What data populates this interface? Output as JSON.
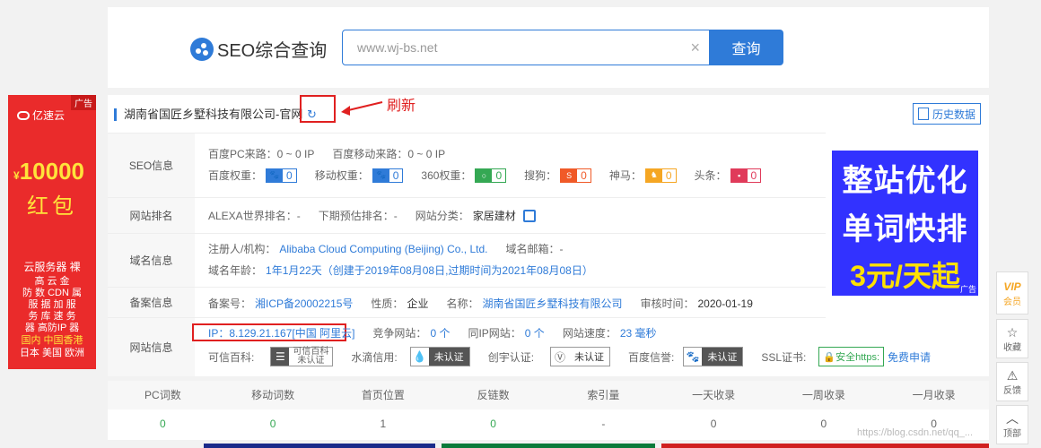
{
  "header": {
    "logo_text": "SEO综合查询",
    "search_value": "www.wj-bs.net",
    "search_button": "查询"
  },
  "left_ad": {
    "tag": "广告",
    "brand": "亿速云",
    "amount_prefix": "¥",
    "amount": "10000",
    "hongbao": "红包",
    "lines": [
      "云服务器 裸",
      "高 云 金",
      "防 数 CDN 属",
      "服 据 加 服",
      "务 库 速 务",
      "器 高防IP 器",
      "国内 中国香港",
      "日本 美国 欧洲"
    ]
  },
  "company": {
    "title": "湖南省国匠乡墅科技有限公司-官网",
    "refresh_annotation": "刷新",
    "history_button": "历史数据"
  },
  "seo_info": {
    "label": "SEO信息",
    "pc_traffic": "百度PC来路：0 ~ 0 IP",
    "mobile_traffic": "百度移动来路：0 ~ 0 IP",
    "baidu_weight_label": "百度权重：",
    "baidu_weight": "0",
    "mobile_weight_label": "移动权重：",
    "mobile_weight": "0",
    "weight360_label": "360权重：",
    "weight360": "0",
    "sogou_label": "搜狗：",
    "sogou": "0",
    "shenma_label": "神马：",
    "shenma": "0",
    "toutiao_label": "头条：",
    "toutiao": "0"
  },
  "site_rank": {
    "label": "网站排名",
    "alexa": "ALEXA世界排名：-",
    "forecast": "下期预估排名：-",
    "category_label": "网站分类：",
    "category": "家居建材"
  },
  "domain_info": {
    "label": "域名信息",
    "registrant_label": "注册人/机构：",
    "registrant": "Alibaba Cloud Computing (Beijing) Co., Ltd.",
    "email": "域名邮箱：-",
    "age_label": "域名年龄：",
    "age": "1年1月22天（创建于2019年08月08日,过期时间为2021年08月08日）"
  },
  "icp_info": {
    "label": "备案信息",
    "icp_label": "备案号：",
    "icp": "湘ICP备20002215号",
    "nature_label": "性质：",
    "nature": "企业",
    "name_label": "名称：",
    "name": "湖南省国匠乡墅科技有限公司",
    "audit_label": "审核时间：",
    "audit": "2020-01-19"
  },
  "site_info": {
    "label": "网站信息",
    "ip": "IP：8.129.21.167[中国 阿里云]",
    "competitors_label": "竞争网站：",
    "competitors": "0 个",
    "same_ip_label": "同IP网站：",
    "same_ip": "0 个",
    "speed_label": "网站速度：",
    "speed": "23 毫秒",
    "kexin_label": "可信百科:",
    "kexin_badge": "可信百科",
    "kexin_status": "未认证",
    "shuidi_label": "水滴信用:",
    "shuidi_status": "未认证",
    "chuangyu_label": "创宇认证:",
    "chuangyu_status": "未认证",
    "baidu_xinyu_label": "百度信誉:",
    "baidu_xinyu_status": "未认证",
    "ssl_label": "SSL证书:",
    "ssl_badge": "安全https:",
    "ssl_link": "免费申请"
  },
  "right_ad": {
    "line1": "整站优化",
    "line2": "单词快排",
    "line3": "3元/天起",
    "tag": "广告"
  },
  "stats": {
    "headers": [
      "PC词数",
      "移动词数",
      "首页位置",
      "反链数",
      "索引量",
      "一天收录",
      "一周收录",
      "一月收录"
    ],
    "values": [
      "0",
      "0",
      "1",
      "0",
      "-",
      "0",
      "0",
      "0"
    ]
  },
  "toolbar": {
    "vip": "会员",
    "favorite": "收藏",
    "feedback": "反馈",
    "top": "顶部"
  },
  "watermark": "https://blog.csdn.net/qq_..."
}
